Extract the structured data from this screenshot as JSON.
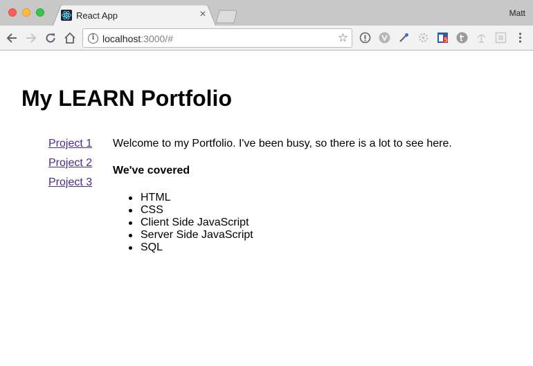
{
  "browser": {
    "tab": {
      "title": "React App",
      "close_glyph": "×",
      "favicon": "react-icon"
    },
    "profile_name": "Matt",
    "address": {
      "host": "localhost",
      "rest": ":3000/#"
    }
  },
  "page": {
    "title": "My LEARN Portfolio",
    "nav": [
      {
        "label": "Project 1"
      },
      {
        "label": "Project 2"
      },
      {
        "label": "Project 3"
      }
    ],
    "welcome": "Welcome to my Portfolio. I've been busy, so there is a lot to see here.",
    "covered_heading": "We've covered",
    "topics": [
      "HTML",
      "CSS",
      "Client Side JavaScript",
      "Server Side JavaScript",
      "SQL"
    ]
  }
}
